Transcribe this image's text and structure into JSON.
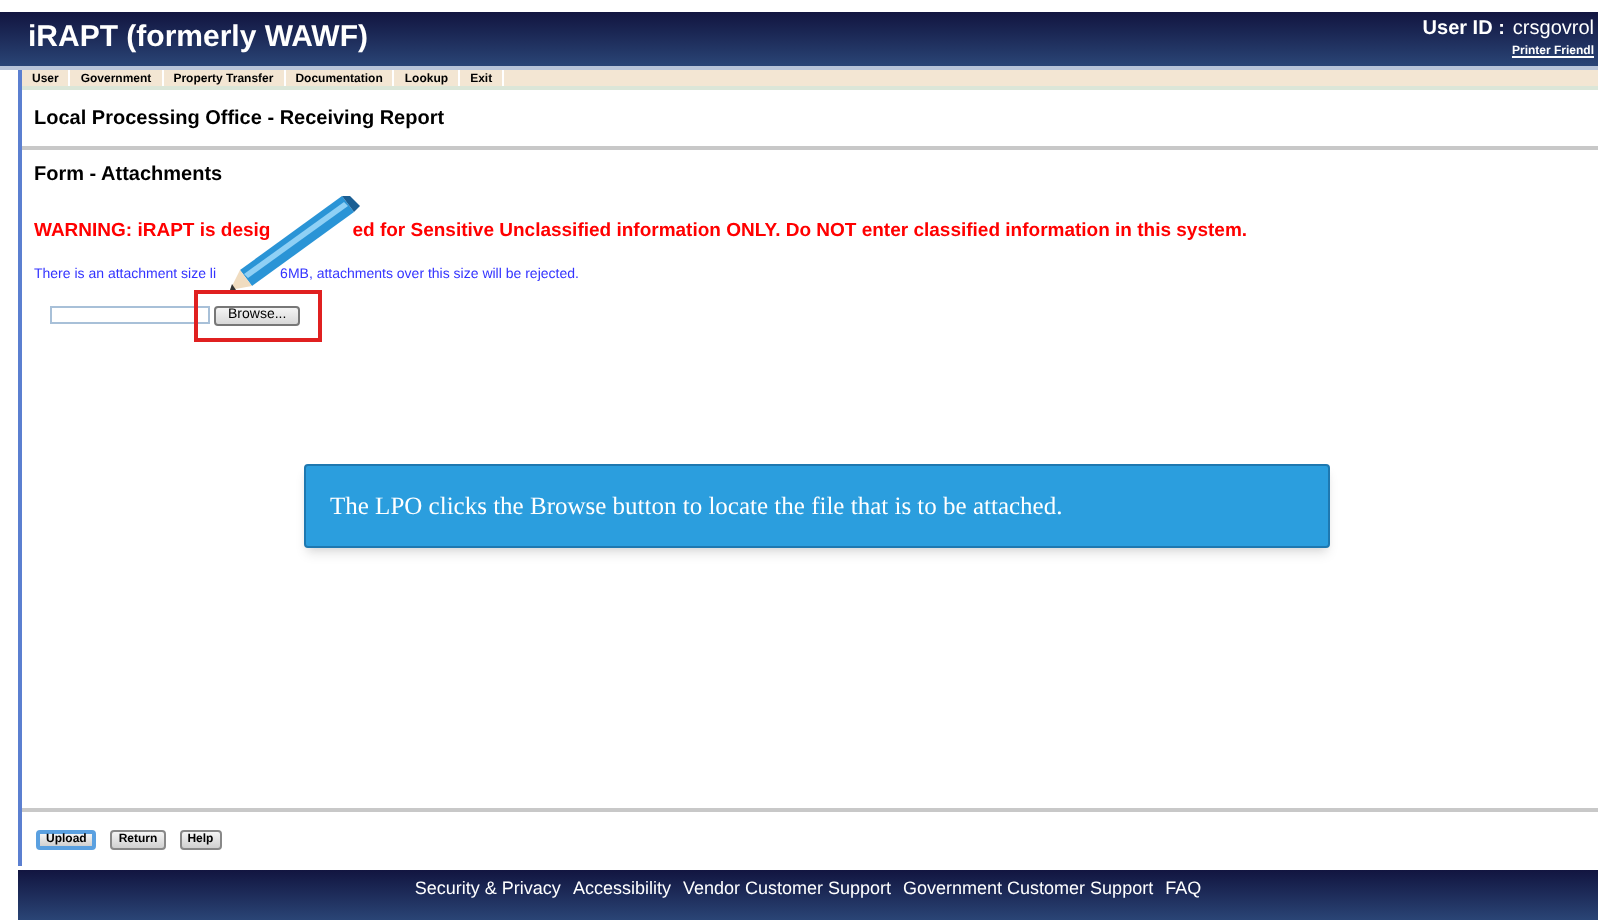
{
  "header": {
    "title": "iRAPT (formerly WAWF)",
    "user_label": "User ID :",
    "user_value": "crsgovrol",
    "printer_link": "Printer Friendl"
  },
  "menu": [
    {
      "label": "User"
    },
    {
      "label": "Government"
    },
    {
      "label": "Property Transfer"
    },
    {
      "label": "Documentation"
    },
    {
      "label": "Lookup"
    },
    {
      "label": "Exit"
    }
  ],
  "page_title": "Local Processing Office - Receiving Report",
  "section_title": "Form - Attachments",
  "warning": {
    "before": "WARNING: iRAPT is desig",
    "after": "ed for Sensitive Unclassified information ONLY. Do NOT enter classified information in this system."
  },
  "notice": {
    "before": "There is an attachment size li",
    "after": "6MB, attachments over this size will be rejected."
  },
  "browse_button": "Browse...",
  "callout": "The LPO clicks the Browse button to locate the file that is to be attached.",
  "buttons": [
    {
      "label": "Upload",
      "selected": true
    },
    {
      "label": "Return",
      "selected": false
    },
    {
      "label": "Help",
      "selected": false
    }
  ],
  "footer_links": [
    "Security & Privacy",
    "Accessibility",
    "Vendor Customer Support",
    "Government Customer Support",
    "FAQ"
  ]
}
